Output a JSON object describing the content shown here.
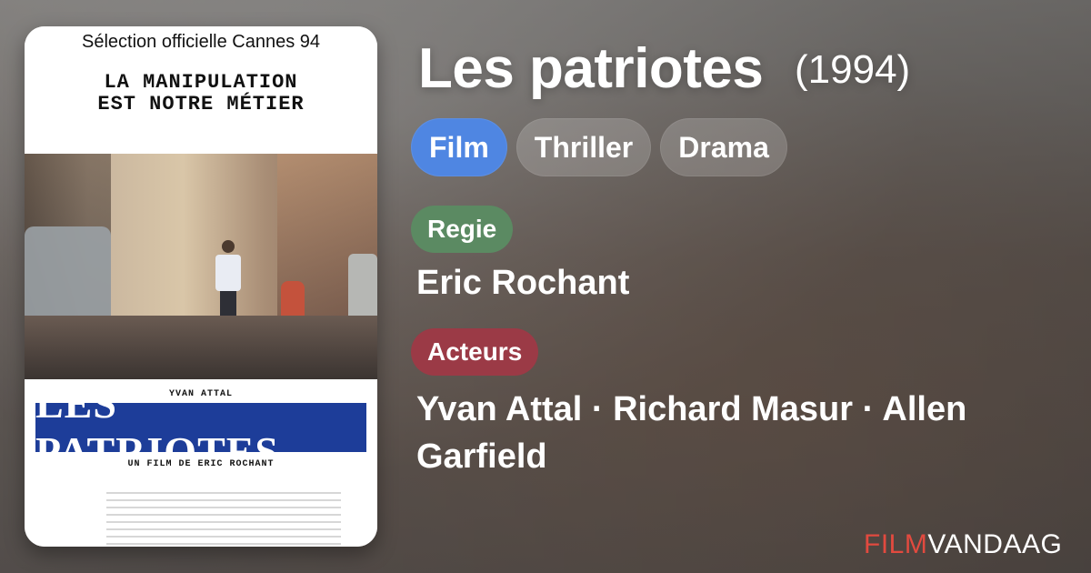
{
  "colors": {
    "film_pill": "#4f86e2",
    "regie_tag": "#5b8a62",
    "acteurs_tag": "#9b3a46",
    "brand_film": "#e24a3f",
    "poster_titlebar": "#1d3d99"
  },
  "poster": {
    "cannes": "Sélection officielle Cannes 94",
    "tagline_line1": "LA MANIPULATION",
    "tagline_line2": "EST NOTRE MÉTIER",
    "actor": "YVAN ATTAL",
    "title": "LES PATRIOTES",
    "byline": "UN FILM DE ERIC ROCHANT"
  },
  "header": {
    "title": "Les patriotes",
    "year": "(1994)"
  },
  "pills": [
    {
      "label": "Film"
    },
    {
      "label": "Thriller"
    },
    {
      "label": "Drama"
    }
  ],
  "sections": {
    "regie_label": "Regie",
    "director": "Eric Rochant",
    "acteurs_label": "Acteurs",
    "actors": "Yvan Attal · Richard Masur · Allen Garfield"
  },
  "brand": {
    "film": "FILM",
    "vandaag": "VANDAAG"
  }
}
